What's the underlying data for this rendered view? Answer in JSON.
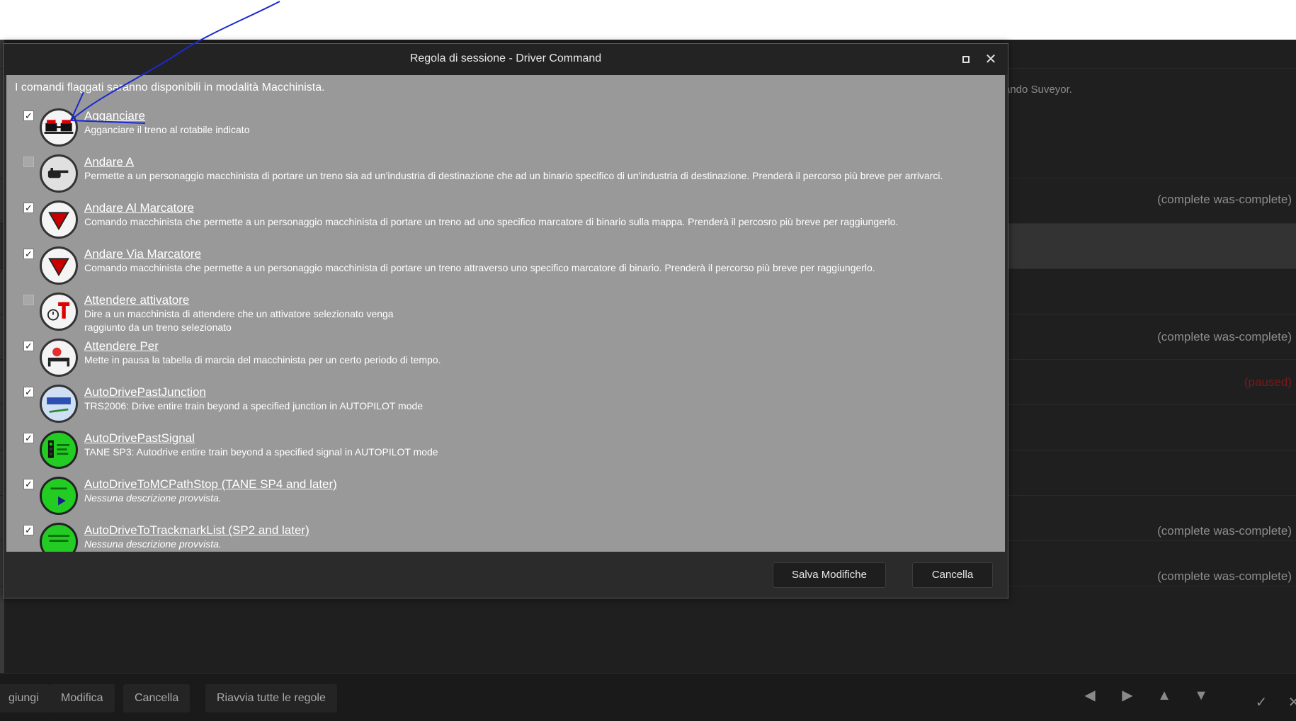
{
  "background": {
    "hint_text": "ando Suveyor.",
    "statuses": [
      {
        "text": "(complete was-complete)",
        "row": 0
      },
      {
        "text": "(complete was-complete)",
        "row": 1
      },
      {
        "text": "(paused)",
        "row": 2
      },
      {
        "text": "(complete was-complete)",
        "row": 3
      },
      {
        "text": "(complete was-complete)",
        "row": 4
      }
    ],
    "bottom_buttons": {
      "add": "giungi",
      "edit": "Modifica",
      "delete": "Cancella",
      "restart_all": "Riavvia tutte le regole"
    },
    "arrow_icons": [
      "arrow-left-icon",
      "arrow-right-icon",
      "arrow-up-icon",
      "arrow-down-icon"
    ]
  },
  "dialog": {
    "title": "Regola di sessione - Driver Command",
    "intro": "I comandi flaggati saranno disponibili in modalità Macchinista.",
    "save_label": "Salva Modifiche",
    "cancel_label": "Cancella",
    "commands": [
      {
        "name": "Agganciare",
        "desc": "Agganciare il treno al rotabile indicato",
        "checked": true,
        "italic": false,
        "icon": "couple-icon"
      },
      {
        "name": "Andare A",
        "desc": "Permette a un personaggio macchinista di portare un treno sia ad un'industria di destinazione che ad un binario specifico di un'industria di destinazione. Prenderà il percorso più breve per arrivarci.",
        "checked": false,
        "italic": false,
        "icon": "pointing-hand-icon"
      },
      {
        "name": "Andare Al Marcatore",
        "desc": "Comando macchinista che permette a un personaggio macchinista di portare un treno ad uno specifico marcatore di binario sulla mappa. Prenderà il percosro più breve per raggiungerlo.",
        "checked": true,
        "italic": false,
        "icon": "marker-icon"
      },
      {
        "name": "Andare Via Marcatore",
        "desc": "Comando macchinista che permette a un personaggio macchinista di portare un treno attraverso uno specifico marcatore di binario. Prenderà il percorso più breve per raggiungerlo.",
        "checked": true,
        "italic": false,
        "icon": "marker-icon"
      },
      {
        "name": "Attendere attivatore",
        "desc": "Dire a un macchinista di attendere che un attivatore selezionato venga\n raggiunto da un treno selezionato",
        "checked": false,
        "italic": false,
        "icon": "trigger-timer-icon"
      },
      {
        "name": "Attendere Per",
        "desc": "Mette in pausa la tabella di marcia del macchinista per un certo periodo di tempo.",
        "checked": true,
        "italic": false,
        "icon": "wait-icon"
      },
      {
        "name": "AutoDrivePastJunction",
        "desc": "TRS2006: Drive entire train beyond  a specified junction in AUTOPILOT mode",
        "checked": true,
        "italic": false,
        "icon": "auto-junction-icon"
      },
      {
        "name": "AutoDrivePastSignal",
        "desc": "TANE SP3: Autodrive entire train beyond a specified signal in AUTOPILOT mode",
        "checked": true,
        "italic": false,
        "icon": "auto-signal-icon"
      },
      {
        "name": "AutoDriveToMCPathStop (TANE SP4 and later)",
        "desc": "Nessuna descrizione provvista.",
        "checked": true,
        "italic": true,
        "icon": "auto-drive-icon"
      },
      {
        "name": "AutoDriveToTrackmarkList (SP2 and later)",
        "desc": "Nessuna descrizione provvista.",
        "checked": true,
        "italic": true,
        "icon": "auto-trackmark-icon"
      }
    ]
  }
}
